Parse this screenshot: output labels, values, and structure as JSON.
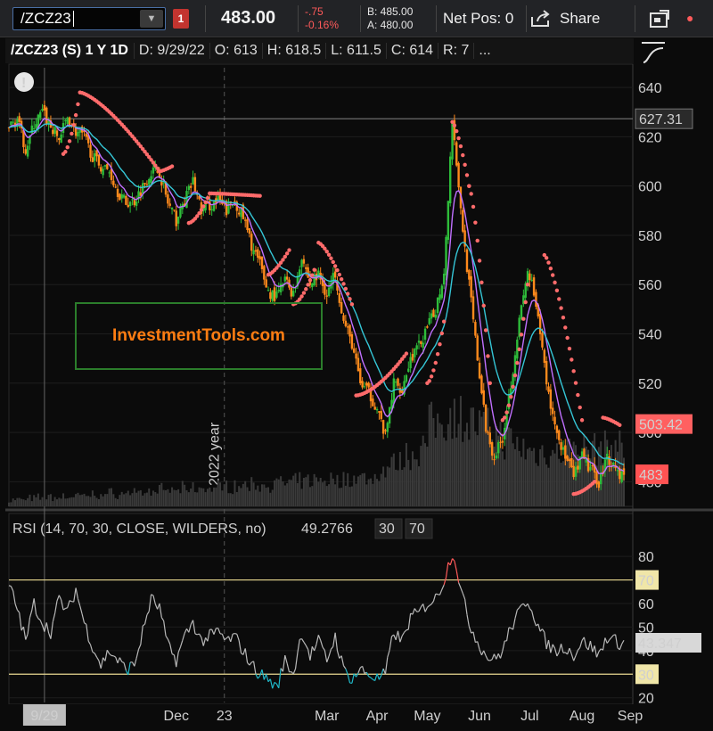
{
  "toolbar": {
    "symbol": "/ZCZ23",
    "badge": "1",
    "last": "483.00",
    "change": "-.75",
    "change_pct": "-0.16%",
    "bid": "B: 485.00",
    "ask": "A: 480.00",
    "net_pos": "Net Pos: 0",
    "share": "Share"
  },
  "header": {
    "symbol_desc": "/ZCZ23 (S) 1 Y 1D",
    "date": "D: 9/29/22",
    "open": "O: 613",
    "high": "H: 618.5",
    "low": "L: 611.5",
    "close": "C: 614",
    "range": "R: 7",
    "more": "..."
  },
  "watermark": "InvestmentTools.com",
  "year_marker": "2022 year",
  "colors": {
    "up": "#2ebd3a",
    "down": "#ff8a1c",
    "sar": "#ff6b6b",
    "ma_fast": "#c070ff",
    "ma_slow": "#35c6d6",
    "rsi_line": "#b8b8b8",
    "rsi_overbought": "#ff5a5a",
    "rsi_oversold": "#20b8c8",
    "level": "#e8d890",
    "bg": "#0b0b0b"
  },
  "chart_data": [
    {
      "type": "candlestick",
      "ylim": [
        470,
        648
      ],
      "yticks": [
        480,
        500,
        520,
        540,
        560,
        580,
        600,
        620,
        640
      ],
      "price_labels": [
        {
          "value": 627.31,
          "text": "627.31",
          "style": "line"
        },
        {
          "value": 503.42,
          "text": "503.42",
          "style": "sar"
        },
        {
          "value": 483,
          "text": "483",
          "style": "last"
        }
      ],
      "close_path": [
        [
          0,
          624
        ],
        [
          4,
          627
        ],
        [
          8,
          615
        ],
        [
          12,
          625
        ],
        [
          16,
          630
        ],
        [
          20,
          624
        ],
        [
          24,
          619
        ],
        [
          28,
          628
        ],
        [
          32,
          622
        ],
        [
          36,
          620
        ],
        [
          40,
          612
        ],
        [
          44,
          608
        ],
        [
          48,
          606
        ],
        [
          52,
          598
        ],
        [
          56,
          593
        ],
        [
          60,
          594
        ],
        [
          64,
          600
        ],
        [
          68,
          606
        ],
        [
          72,
          606
        ],
        [
          76,
          593
        ],
        [
          80,
          586
        ],
        [
          84,
          594
        ],
        [
          88,
          602
        ],
        [
          92,
          590
        ],
        [
          96,
          592
        ],
        [
          100,
          594
        ],
        [
          104,
          590
        ],
        [
          108,
          594
        ],
        [
          112,
          587
        ],
        [
          116,
          576
        ],
        [
          120,
          568
        ],
        [
          124,
          557
        ],
        [
          128,
          555
        ],
        [
          132,
          562
        ],
        [
          136,
          556
        ],
        [
          140,
          572
        ],
        [
          144,
          560
        ],
        [
          148,
          564
        ],
        [
          152,
          556
        ],
        [
          156,
          565
        ],
        [
          160,
          545
        ],
        [
          164,
          536
        ],
        [
          168,
          520
        ],
        [
          172,
          516
        ],
        [
          176,
          510
        ],
        [
          180,
          498
        ],
        [
          184,
          520
        ],
        [
          188,
          518
        ],
        [
          192,
          530
        ],
        [
          196,
          535
        ],
        [
          200,
          542
        ],
        [
          204,
          550
        ],
        [
          208,
          565
        ],
        [
          212,
          627
        ],
        [
          214,
          610
        ],
        [
          216,
          590
        ],
        [
          220,
          560
        ],
        [
          224,
          530
        ],
        [
          228,
          502
        ],
        [
          232,
          490
        ],
        [
          236,
          498
        ],
        [
          240,
          520
        ],
        [
          244,
          545
        ],
        [
          248,
          565
        ],
        [
          250,
          560
        ],
        [
          254,
          540
        ],
        [
          258,
          515
        ],
        [
          262,
          500
        ],
        [
          266,
          490
        ],
        [
          270,
          482
        ],
        [
          274,
          490
        ],
        [
          278,
          485
        ],
        [
          282,
          480
        ],
        [
          286,
          490
        ],
        [
          290,
          486
        ],
        [
          292,
          483
        ]
      ],
      "sar_segments": [
        {
          "start": [
            26,
            613
          ],
          "end": [
            34,
            638
          ],
          "above": false
        },
        {
          "start": [
            34,
            638
          ],
          "end": [
            72,
            606
          ],
          "above": true
        },
        {
          "start": [
            72,
            606
          ],
          "end": [
            78,
            608
          ],
          "above": true
        },
        {
          "start": [
            86,
            585
          ],
          "end": [
            96,
            597
          ],
          "above": false
        },
        {
          "start": [
            96,
            597
          ],
          "end": [
            120,
            596
          ],
          "above": true
        },
        {
          "start": [
            124,
            564
          ],
          "end": [
            134,
            574
          ],
          "above": true
        },
        {
          "start": [
            136,
            552
          ],
          "end": [
            146,
            566
          ],
          "above": false
        },
        {
          "start": [
            148,
            577
          ],
          "end": [
            164,
            552
          ],
          "above": true
        },
        {
          "start": [
            166,
            515
          ],
          "end": [
            190,
            532
          ],
          "above": false
        },
        {
          "start": [
            200,
            520
          ],
          "end": [
            208,
            545
          ],
          "above": false
        },
        {
          "start": [
            212,
            626
          ],
          "end": [
            220,
            600
          ],
          "above": true
        },
        {
          "start": [
            220,
            600
          ],
          "end": [
            230,
            520
          ],
          "above": true
        },
        {
          "start": [
            236,
            505
          ],
          "end": [
            248,
            560
          ],
          "above": false
        },
        {
          "start": [
            256,
            572
          ],
          "end": [
            274,
            505
          ],
          "above": true
        },
        {
          "start": [
            270,
            475
          ],
          "end": [
            280,
            480
          ],
          "above": false
        },
        {
          "start": [
            284,
            506
          ],
          "end": [
            292,
            503
          ],
          "above": true
        }
      ],
      "volume_peak_index": 212
    },
    {
      "type": "line",
      "title": "RSI (14, 70, 30, CLOSE, WILDERS, no)",
      "value_label": "49.2766",
      "level_labels": [
        "30",
        "70"
      ],
      "ylim": [
        18,
        88
      ],
      "yticks": [
        20,
        30,
        40,
        50,
        60,
        70,
        80
      ],
      "overbought": 70,
      "oversold": 30,
      "current": {
        "value": 43.347,
        "text": "43.347"
      },
      "points": [
        [
          0,
          68
        ],
        [
          4,
          58
        ],
        [
          8,
          44
        ],
        [
          12,
          60
        ],
        [
          16,
          52
        ],
        [
          20,
          48
        ],
        [
          24,
          62
        ],
        [
          28,
          56
        ],
        [
          32,
          66
        ],
        [
          36,
          52
        ],
        [
          40,
          42
        ],
        [
          44,
          34
        ],
        [
          48,
          40
        ],
        [
          52,
          36
        ],
        [
          56,
          32
        ],
        [
          60,
          34
        ],
        [
          64,
          48
        ],
        [
          68,
          62
        ],
        [
          72,
          58
        ],
        [
          76,
          42
        ],
        [
          80,
          36
        ],
        [
          84,
          46
        ],
        [
          88,
          52
        ],
        [
          92,
          44
        ],
        [
          96,
          46
        ],
        [
          100,
          48
        ],
        [
          104,
          44
        ],
        [
          108,
          46
        ],
        [
          112,
          40
        ],
        [
          116,
          34
        ],
        [
          120,
          30
        ],
        [
          124,
          28
        ],
        [
          128,
          24
        ],
        [
          132,
          36
        ],
        [
          136,
          30
        ],
        [
          140,
          48
        ],
        [
          144,
          38
        ],
        [
          148,
          44
        ],
        [
          152,
          36
        ],
        [
          156,
          46
        ],
        [
          160,
          32
        ],
        [
          164,
          28
        ],
        [
          168,
          32
        ],
        [
          172,
          30
        ],
        [
          176,
          28
        ],
        [
          180,
          30
        ],
        [
          184,
          48
        ],
        [
          188,
          44
        ],
        [
          192,
          54
        ],
        [
          196,
          56
        ],
        [
          200,
          60
        ],
        [
          204,
          62
        ],
        [
          208,
          70
        ],
        [
          212,
          82
        ],
        [
          214,
          76
        ],
        [
          216,
          66
        ],
        [
          220,
          52
        ],
        [
          224,
          44
        ],
        [
          228,
          38
        ],
        [
          232,
          36
        ],
        [
          236,
          40
        ],
        [
          240,
          50
        ],
        [
          244,
          56
        ],
        [
          248,
          62
        ],
        [
          250,
          58
        ],
        [
          254,
          48
        ],
        [
          258,
          42
        ],
        [
          262,
          40
        ],
        [
          266,
          42
        ],
        [
          270,
          38
        ],
        [
          274,
          44
        ],
        [
          278,
          42
        ],
        [
          282,
          38
        ],
        [
          286,
          46
        ],
        [
          290,
          44
        ],
        [
          292,
          43.3
        ]
      ]
    }
  ],
  "x_axis": {
    "domain": [
      0,
      294
    ],
    "ticks": [
      {
        "pos": 17,
        "label": "9/29",
        "boxed": true
      },
      {
        "pos": 80,
        "label": "Dec"
      },
      {
        "pos": 103,
        "label": "23"
      },
      {
        "pos": 152,
        "label": "Mar"
      },
      {
        "pos": 176,
        "label": "Apr"
      },
      {
        "pos": 200,
        "label": "May"
      },
      {
        "pos": 225,
        "label": "Jun"
      },
      {
        "pos": 249,
        "label": "Jul"
      },
      {
        "pos": 274,
        "label": "Aug"
      },
      {
        "pos": 297,
        "label": "Sep"
      }
    ]
  }
}
